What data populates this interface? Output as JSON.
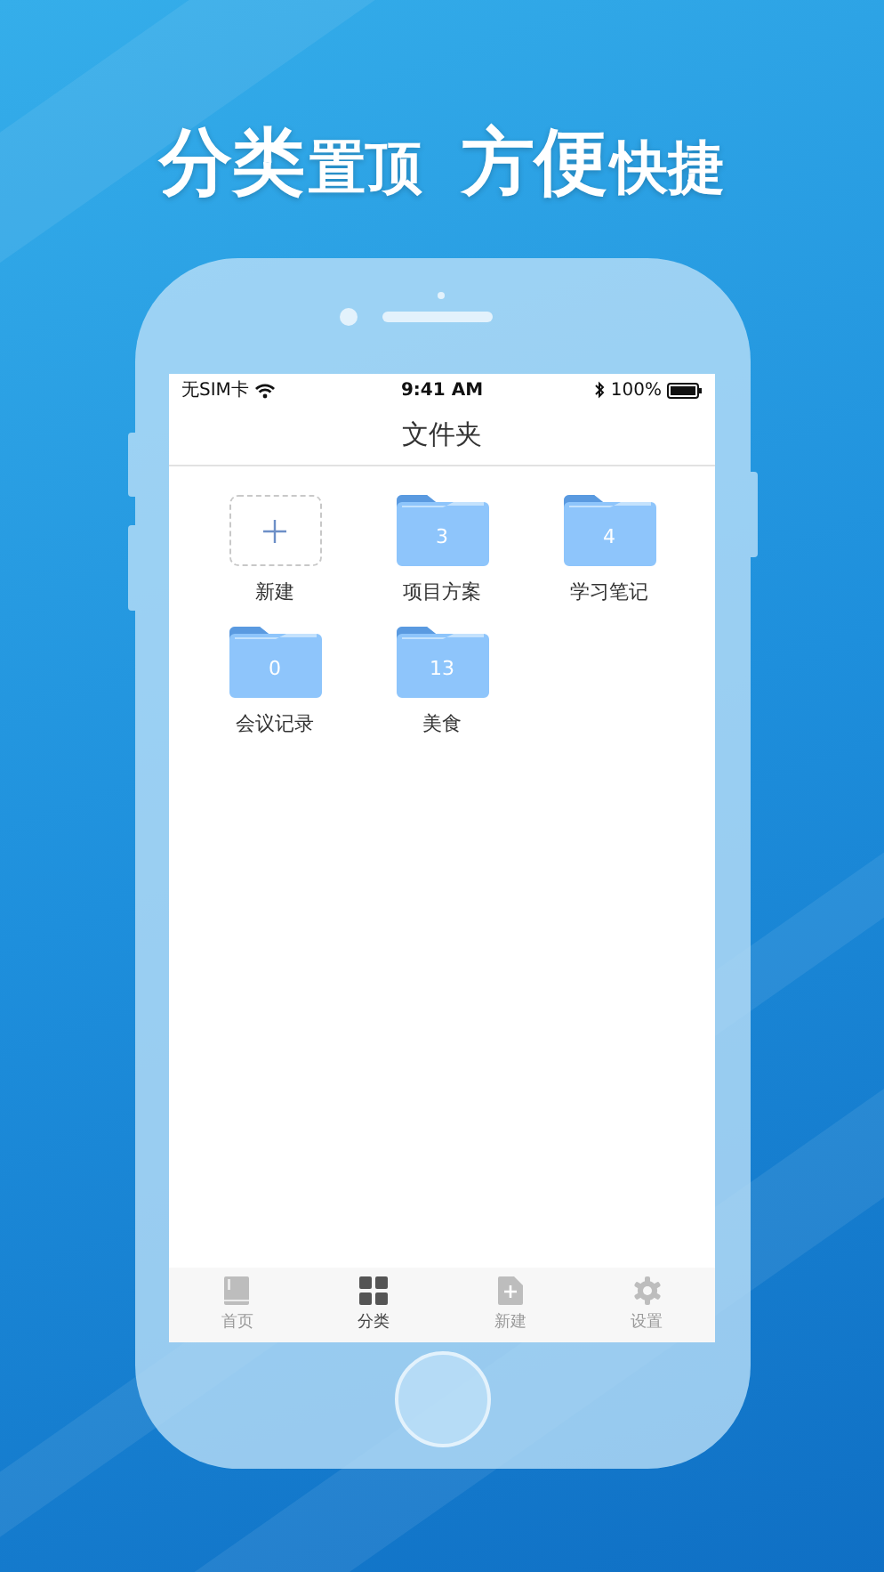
{
  "headline": [
    {
      "main": "分类",
      "sub": "置顶"
    },
    {
      "main": "方便",
      "sub": "快捷"
    }
  ],
  "status_bar": {
    "carrier": "无SIM卡",
    "time": "9:41 AM",
    "battery": "100%"
  },
  "nav_bar": {
    "title": "文件夹"
  },
  "folders": [
    {
      "kind": "add",
      "label": "新建"
    },
    {
      "kind": "folder",
      "count": "3",
      "label": "项目方案"
    },
    {
      "kind": "folder",
      "count": "4",
      "label": "学习笔记"
    },
    {
      "kind": "folder",
      "count": "0",
      "label": "会议记录"
    },
    {
      "kind": "folder",
      "count": "13",
      "label": "美食"
    }
  ],
  "tab_bar": [
    {
      "label": "首页",
      "selected": false
    },
    {
      "label": "分类",
      "selected": true
    },
    {
      "label": "新建",
      "selected": false
    },
    {
      "label": "设置",
      "selected": false
    }
  ]
}
